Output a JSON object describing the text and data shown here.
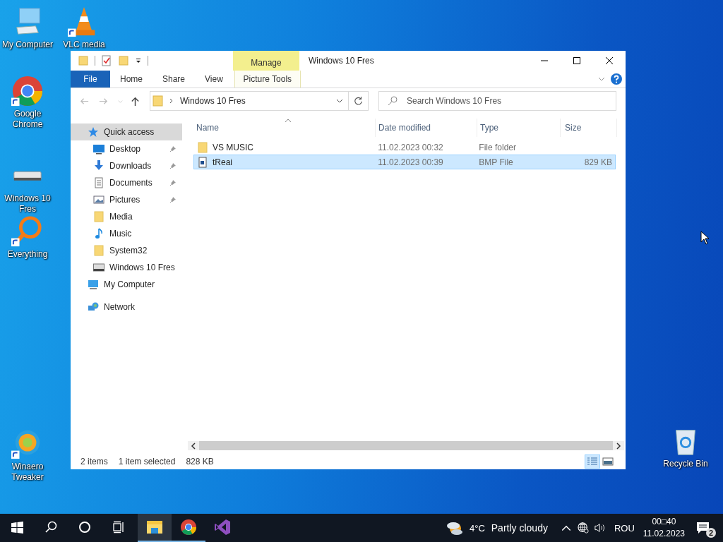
{
  "desktop_icons": [
    {
      "label": "My Computer",
      "kind": "computer",
      "shortcut": false
    },
    {
      "label": "VLC media",
      "kind": "cone",
      "shortcut": true
    },
    {
      "label": "Google Chrome",
      "kind": "chrome",
      "shortcut": true
    },
    {
      "label": "Windows 10 Fres",
      "kind": "drive",
      "shortcut": false
    },
    {
      "label": "Everything",
      "kind": "magnifier",
      "shortcut": true
    },
    {
      "label": "Winaero Tweaker",
      "kind": "swirl",
      "shortcut": true
    },
    {
      "label": "Recycle Bin",
      "kind": "bin",
      "shortcut": false
    }
  ],
  "explorer": {
    "contextual_tab": {
      "label": "Manage"
    },
    "title": "Windows 10 Fres",
    "ribbon_tabs": [
      {
        "label": "File",
        "kind": "file"
      },
      {
        "label": "Home",
        "kind": "tab"
      },
      {
        "label": "Share",
        "kind": "tab"
      },
      {
        "label": "View",
        "kind": "tab"
      },
      {
        "label": "Picture Tools",
        "kind": "contextual"
      }
    ],
    "address": "Windows 10 Fres",
    "search": {
      "placeholder": "Search Windows 10 Fres"
    },
    "navigation": [
      {
        "label": "Quick access",
        "kind": "star",
        "selected": true,
        "children": [
          {
            "label": "Desktop",
            "kind": "desktop",
            "pinned": true,
            "selected": false
          },
          {
            "label": "Downloads",
            "kind": "download",
            "pinned": true,
            "selected": false
          },
          {
            "label": "Documents",
            "kind": "document",
            "pinned": true,
            "selected": false
          },
          {
            "label": "Pictures",
            "kind": "pictures",
            "pinned": true,
            "selected": false
          },
          {
            "label": "Media",
            "kind": "folder",
            "pinned": false,
            "selected": false
          },
          {
            "label": "Music",
            "kind": "music",
            "pinned": false,
            "selected": false
          },
          {
            "label": "System32",
            "kind": "folder",
            "pinned": false,
            "selected": false
          },
          {
            "label": "Windows 10 Fres",
            "kind": "drive",
            "pinned": false,
            "selected": false
          }
        ]
      },
      {
        "label": "My Computer",
        "kind": "computer",
        "selected": false
      },
      {
        "label": "Network",
        "kind": "network",
        "selected": false
      }
    ],
    "columns": [
      "Name",
      "Date modified",
      "Type",
      "Size"
    ],
    "files": [
      {
        "name": "VS MUSIC",
        "kind": "folder",
        "date": "11.02.2023 00:32",
        "type": "File folder",
        "selected": false
      },
      {
        "name": "tReai",
        "kind": "image",
        "date": "11.02.2023 00:39",
        "type": "BMP File",
        "size": "829 KB",
        "selected": true
      }
    ],
    "status": {
      "count": "2 items",
      "selection": "1 item selected",
      "size": "828 KB"
    },
    "views": [
      {
        "kind": "details",
        "selected": true
      },
      {
        "kind": "thumbnails",
        "selected": false
      }
    ]
  },
  "taskbar": {
    "apps": [
      {
        "kind": "explorer",
        "selected": true,
        "running": true
      },
      {
        "kind": "chrome",
        "selected": false,
        "running": true
      },
      {
        "kind": "studio",
        "selected": false,
        "running": false
      }
    ],
    "weather": {
      "temperature": "4°C",
      "condition": "Partly cloudy"
    },
    "language": "ROU",
    "time": "00□40",
    "date": "11.02.2023",
    "notifications": "2"
  }
}
